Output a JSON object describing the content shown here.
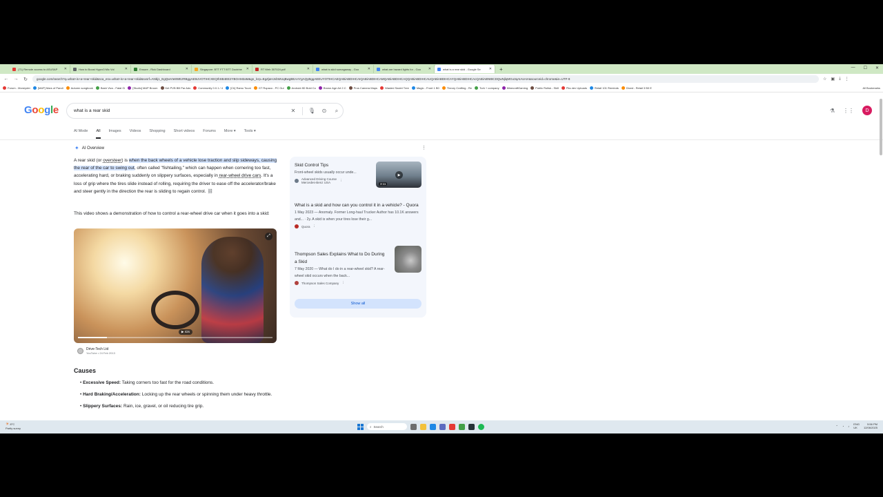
{
  "browser": {
    "tabs": [
      {
        "title": "(71) Remote access to ASUSAP",
        "color": "#e53935"
      },
      {
        "title": "How to Boost Hyprx3 Mic Vol",
        "color": "#5f6368"
      },
      {
        "title": "Ensure - Rick Dashboard",
        "color": "#2e7d32"
      },
      {
        "title": "Singapore: BTT FTT BTT Doctrine",
        "color": "#f9a825"
      },
      {
        "title": "RT Web 307024.pdf",
        "color": "#c62828"
      },
      {
        "title": "what is skid sumagaway - Goo",
        "color": "#4285f4"
      },
      {
        "title": "what are hazard lights for - Goo",
        "color": "#4285f4"
      },
      {
        "title": "what is a rear skid - Google Se",
        "color": "#4285f4"
      }
    ],
    "url": "google.com/search?q=what+is+a+rear+skid&sca_esv=what+is+a+rear+skid&sxsrf=ANbj1_EgQwVIe8WEzRBggAE5UVOTIHCXEQIhSB4EE2YBOAM2aM&gs_lcrp=EgZjaHJvbWUqBwgBEAAYgAQyBggAEEUYOTIHCAEQABiABDIHCAIQABiABDIHCAMQABiABDIHCAQQABiABDIHCAUQABiABDIHCAYQABiABDIHCAcQABiABNIBCDQwNjlqMGo3qAIAsAIA&sourceid=chrome&ie=UTF-8",
    "bookmarks": [
      "Forum - Moneyder",
      "[M&P] Mars of Pandi",
      "Autumn songbook",
      "Bash Viva - Fatal Gi",
      "[Studio] M&P Broom",
      "Ket PVB BB Par Ads",
      "Community 0.0.1 / 4",
      "[Ch] Ramu Touni",
      "GT Rupaco - PC Gui",
      "Android 8D Bold Co",
      "Brown Age Art 2.C",
      "Pros Camera Maps",
      "Wasted Saviet Tree",
      "Magic - Front 1 B0",
      "Theory Crafting - Re",
      "Turk + company",
      "MinecraftGaming",
      "Public Rollsk - Skill",
      "Pks dev Uploads",
      "Retail 101 Reminds",
      "Diced - Retail 3 B0 E"
    ],
    "all_bookmarks": "All Bookmarks"
  },
  "google": {
    "logo": "Google",
    "query": "what is a rear skid",
    "tabs": [
      "AI Mode",
      "All",
      "Images",
      "Videos",
      "Shopping",
      "Short videos",
      "Forums",
      "More",
      "Tools"
    ],
    "avatar_initial": "D"
  },
  "ai_overview": {
    "heading": "AI Overview",
    "p1_a": "A rear skid (or ",
    "p1_link1": "oversteer",
    "p1_b": ") is ",
    "p1_highlight": "when the back wheels of a vehicle lose traction and slip sideways, causing the rear of the car to swing out",
    "p1_c": ", often called \"fishtailing,\" which can happen when cornering too fast, accelerating hard, or braking suddenly on slippery surfaces, especially in ",
    "p1_link2": "rear-wheel drive cars",
    "p1_d": ". It's a loss of grip where the tires slide instead of rolling, requiring the driver to ease off the accelerator/brake and steer gently in the direction the rear is sliding to regain control.",
    "p2": "This video shows a demonstration of how to control a rear-wheel drive car when it goes into a skid:",
    "video": {
      "duration_badge": "▶ 42s",
      "progress": 0.15,
      "channel": "Drive-Tech Ltd",
      "meta": "YouTube • 24 Feb 2013"
    },
    "causes_heading": "Causes",
    "causes": [
      {
        "term": "Excessive Speed:",
        "desc": " Taking corners too fast for the road conditions."
      },
      {
        "term": "Hard Braking/Acceleration:",
        "desc": " Locking up the rear wheels or spinning them under heavy throttle."
      },
      {
        "term": "Slippery Surfaces:",
        "desc": " Rain, ice, gravel, or oil reducing tire grip."
      }
    ]
  },
  "sources": [
    {
      "title": "Skid Control Tips",
      "snippet": "Front-wheel skids usually occur unde...",
      "source": "Advanced Driving Course",
      "source2": "Mercedes-Benz USA",
      "duration": "3:11",
      "dot_color": "#6c7a89"
    },
    {
      "title": "What is a skid and how can you control it in a vehicle? - Quora",
      "snippet": "1 May 2023 — Anomaly. Former Long-haul Trucker Author has 10.1K answers and... · 2y. A skid is when your tires lose their g...",
      "source": "Quora",
      "dot_color": "#b92b27"
    },
    {
      "title": "Thompson Sales Explains What to Do During a Skid",
      "snippet": "7 May 2020 — What do I do in a rear-wheel skid? A rear-wheel skid occurs when the back...",
      "source": "Thompson Sales Company",
      "dot_color": "#b0413e"
    }
  ],
  "show_all": "Show all",
  "taskbar": {
    "weather_temp": "8°C",
    "weather_desc": "Partly sunny",
    "search_placeholder": "Search",
    "lang": "ENG",
    "lang2": "UK",
    "time": "5:56 PM",
    "date": "12/06/2025"
  }
}
